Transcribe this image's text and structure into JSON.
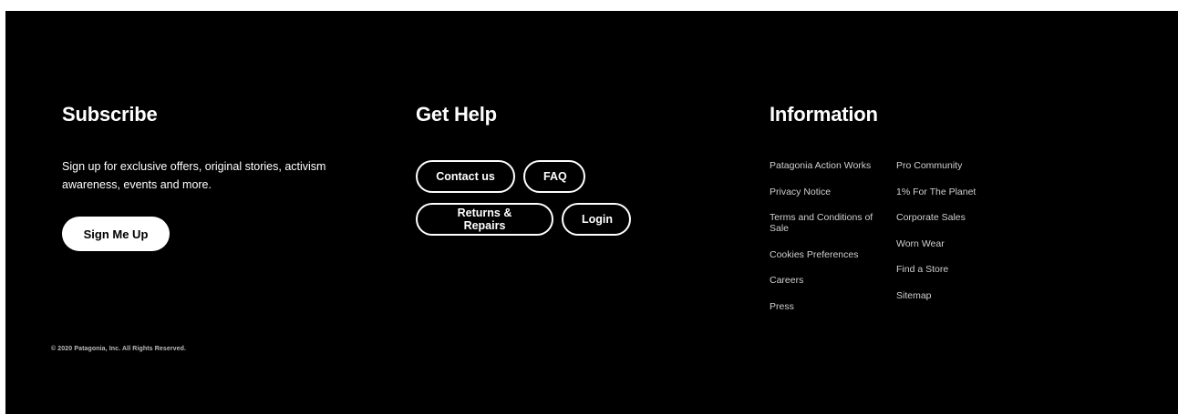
{
  "subscribe": {
    "heading": "Subscribe",
    "description": "Sign up for exclusive offers, original stories, activism awareness, events and more.",
    "button_label": "Sign Me Up"
  },
  "help": {
    "heading": "Get Help",
    "buttons_row1": [
      "Contact us",
      "FAQ"
    ],
    "buttons_row2": [
      "Returns & Repairs",
      "Login"
    ]
  },
  "information": {
    "heading": "Information",
    "column1": [
      "Patagonia Action Works",
      "Privacy Notice",
      "Terms and Conditions of Sale",
      "Cookies Preferences",
      "Careers",
      "Press"
    ],
    "column2": [
      "Pro Community",
      "1% For The Planet",
      "Corporate Sales",
      "Worn Wear",
      "Find a Store",
      "Sitemap"
    ]
  },
  "copyright": "© 2020 Patagonia, Inc. All Rights Reserved.",
  "colors": {
    "background": "#000000",
    "text": "#ffffff",
    "link": "#cfcfcf"
  }
}
